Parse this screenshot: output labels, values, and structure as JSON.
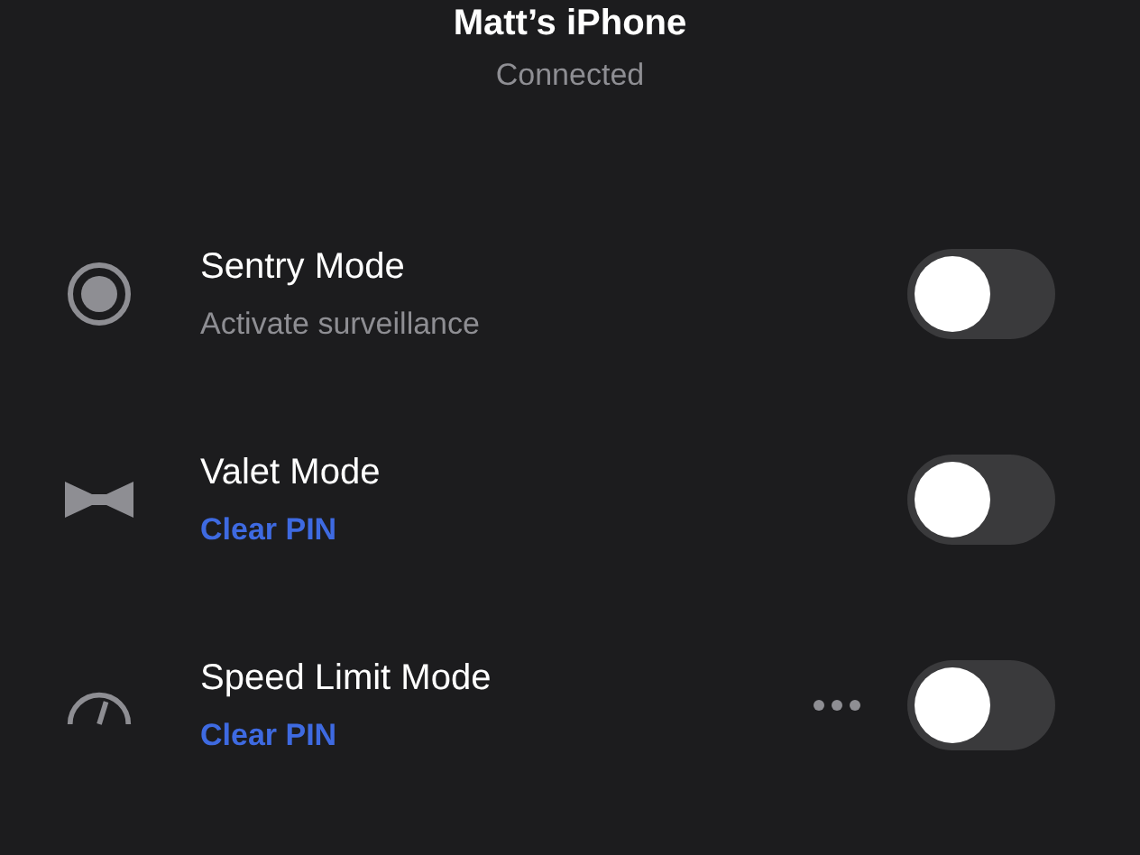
{
  "header": {
    "title": "Matt’s iPhone",
    "status": "Connected"
  },
  "rows": [
    {
      "kind": "sentry",
      "title": "Sentry Mode",
      "subtitle": "Activate surveillance",
      "subtitle_link": false,
      "more": false,
      "on": false
    },
    {
      "kind": "valet",
      "title": "Valet Mode",
      "subtitle": "Clear PIN",
      "subtitle_link": true,
      "more": false,
      "on": false
    },
    {
      "kind": "speed",
      "title": "Speed Limit Mode",
      "subtitle": "Clear PIN",
      "subtitle_link": true,
      "more": true,
      "on": false
    }
  ]
}
